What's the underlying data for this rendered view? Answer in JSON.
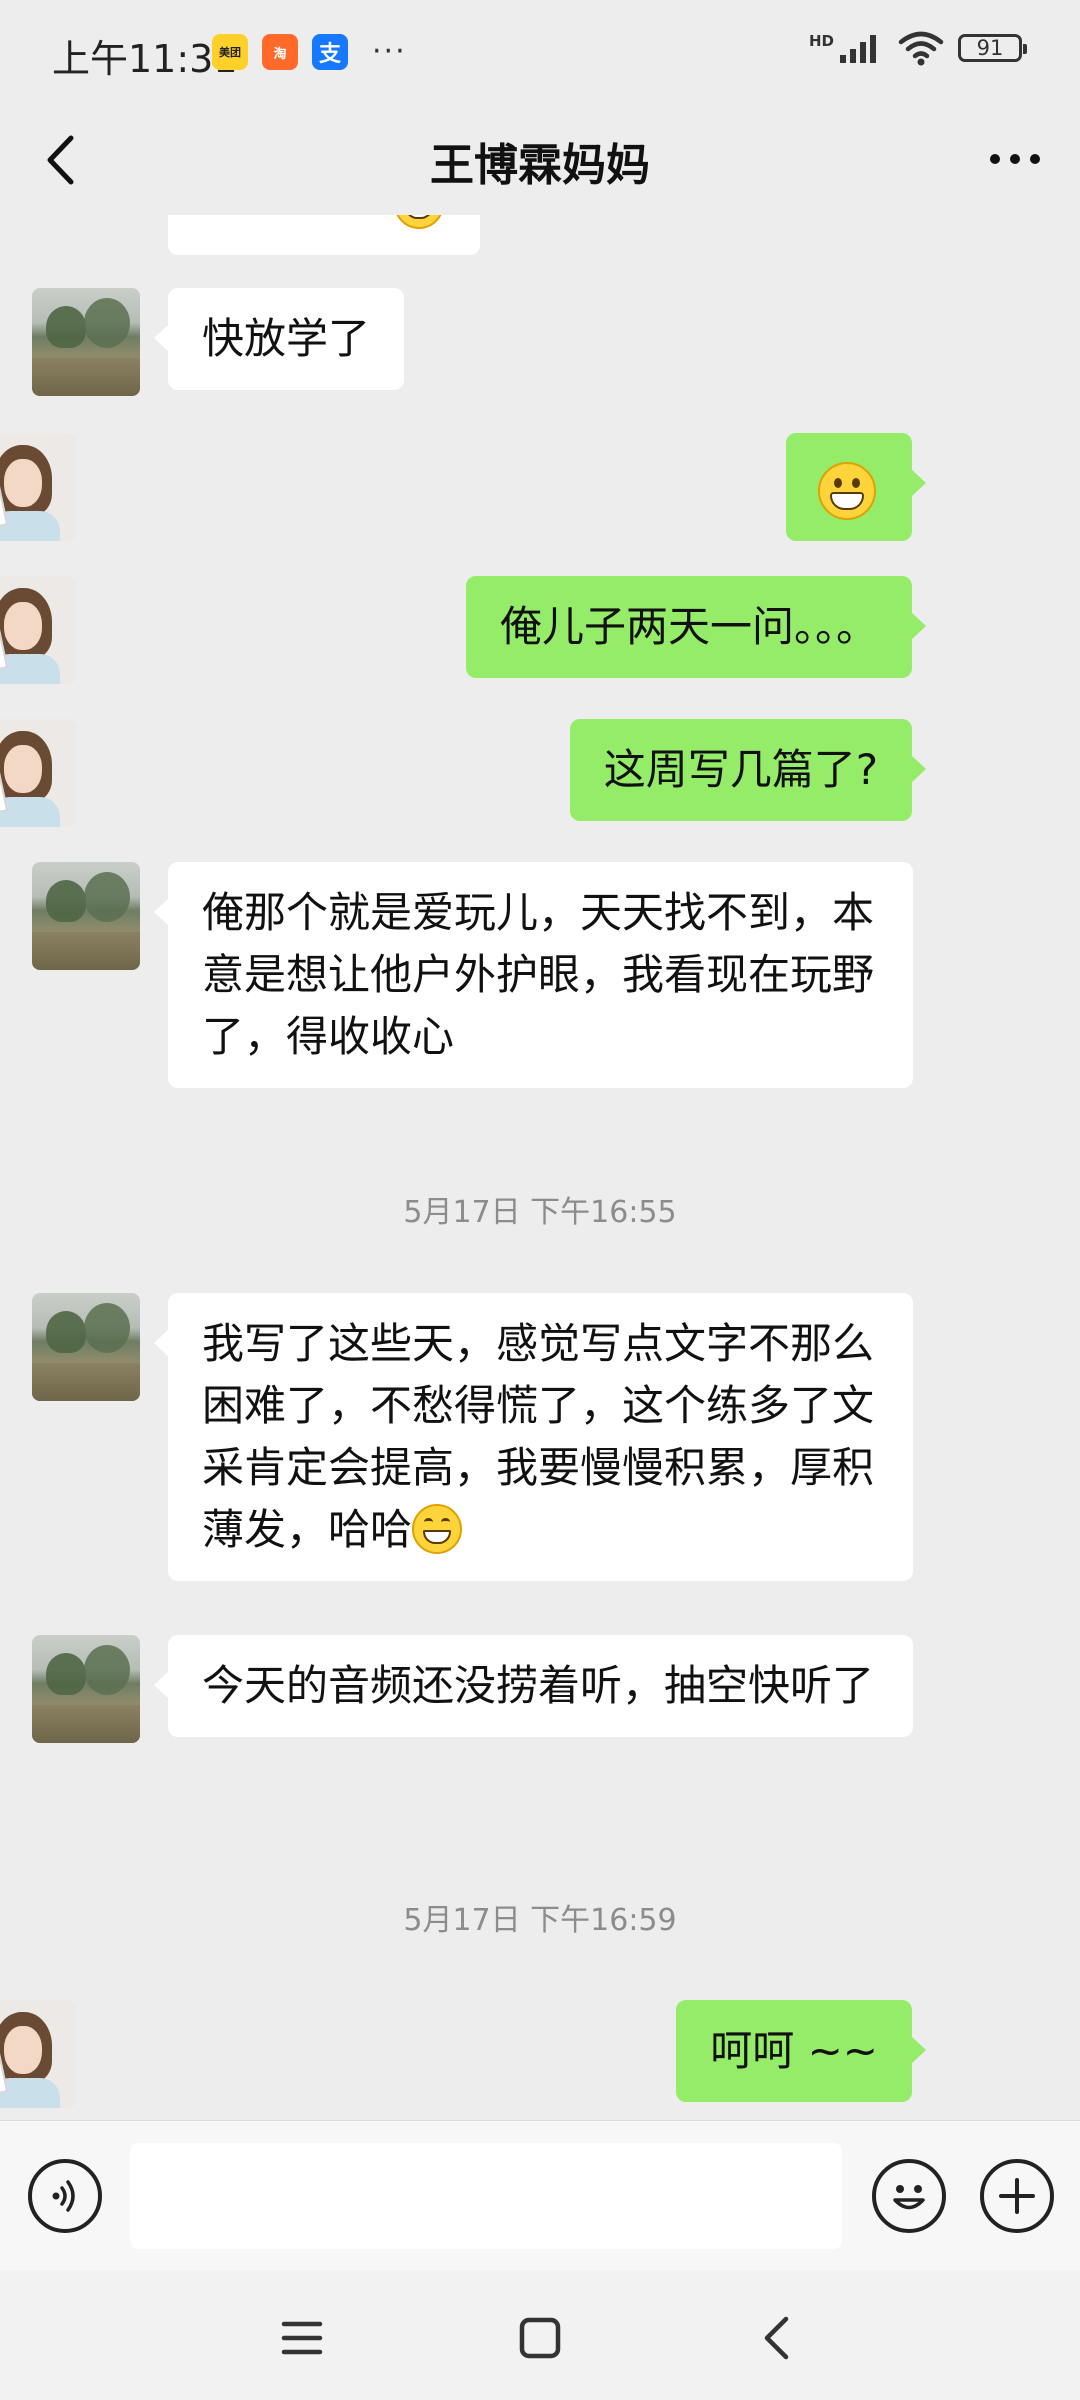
{
  "status_bar": {
    "time": "上午11:31",
    "apps": [
      {
        "name": "meituan-icon",
        "label": "美团"
      },
      {
        "name": "taobao-icon",
        "label": "淘"
      },
      {
        "name": "alipay-icon",
        "label": "支"
      }
    ],
    "more": "···",
    "network": "HD",
    "battery": "91"
  },
  "header": {
    "title": "王博霖妈妈"
  },
  "messages": [
    {
      "side": "in",
      "text": "快放学了"
    },
    {
      "side": "out",
      "type": "emoji",
      "emoji": "grinning-face"
    },
    {
      "side": "out",
      "text": "俺儿子两天一问。。。"
    },
    {
      "side": "out",
      "text": "这周写几篇了?"
    },
    {
      "side": "in",
      "text": "俺那个就是爱玩儿，天天找不到，本意是想让他户外护眼，我看现在玩野了，得收收心"
    },
    {
      "type": "timestamp",
      "text": "5月17日 下午16:55"
    },
    {
      "side": "in",
      "text": "我写了这些天，感觉写点文字不那么困难了，不愁得慌了，这个练多了文采肯定会提高，我要慢慢积累，厚积薄发，哈哈",
      "emoji": "smiling-face"
    },
    {
      "side": "in",
      "text": "今天的音频还没捞着听，抽空快听了"
    },
    {
      "type": "timestamp",
      "text": "5月17日 下午16:59"
    },
    {
      "side": "out",
      "text": "呵呵 ~~"
    }
  ],
  "input": {
    "value": "",
    "placeholder": ""
  },
  "colors": {
    "background": "#ededed",
    "incoming_bubble": "#ffffff",
    "outgoing_bubble": "#95ec69",
    "timestamp": "#8c8c8c"
  }
}
